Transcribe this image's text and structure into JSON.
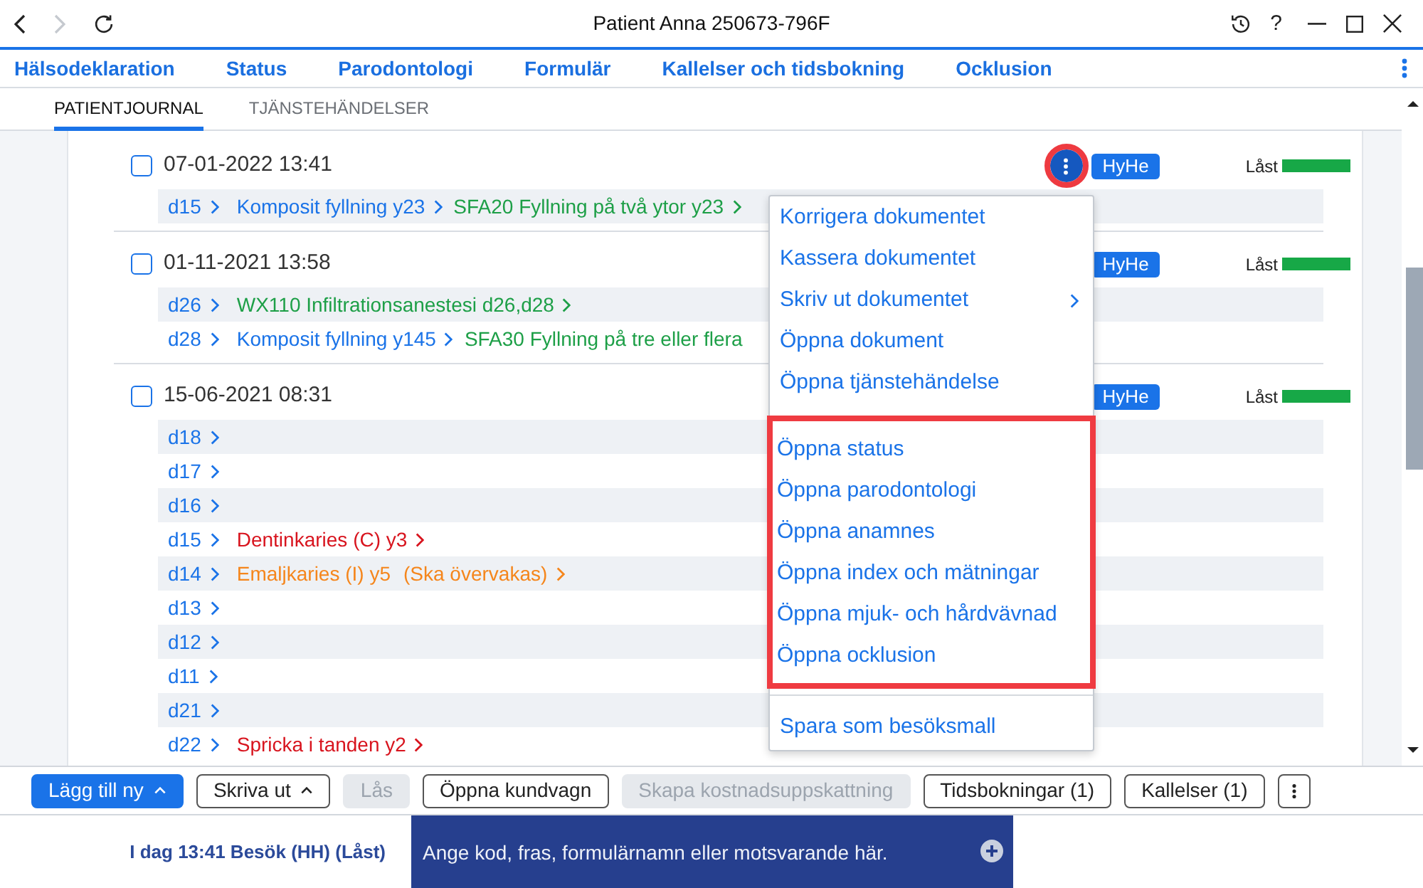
{
  "window": {
    "title": "Patient Anna 250673-796F",
    "help": "?"
  },
  "nav": {
    "items": [
      "Hälsodeklaration",
      "Status",
      "Parodontologi",
      "Formulär",
      "Kallelser och tidsbokning",
      "Ocklusion"
    ]
  },
  "subtabs": [
    {
      "label": "PATIENTJOURNAL",
      "selected": true
    },
    {
      "label": "TJÄNSTEHÄNDELSER",
      "selected": false
    }
  ],
  "entries": [
    {
      "date": "07-01-2022 13:41",
      "checked": false,
      "menu_button": {
        "highlighted": true
      },
      "badge": "HyHe",
      "lock": {
        "label": "Låst",
        "color": "#17a847"
      },
      "rows": [
        {
          "tooth": "d15",
          "items": [
            {
              "kind": "procedure",
              "text": "Komposit fyllning y23",
              "chevron": true
            },
            {
              "kind": "service",
              "text": "SFA20 Fyllning på två ytor y23",
              "chevron": true
            }
          ]
        }
      ]
    },
    {
      "date": "01-11-2021 13:58",
      "checked": false,
      "badge": "HyHe",
      "lock": {
        "label": "Låst",
        "color": "#17a847"
      },
      "rows": [
        {
          "tooth": "d26",
          "items": [
            {
              "kind": "service",
              "text": "WX110 Infiltrationsanestesi d26,d28",
              "chevron": true
            }
          ]
        },
        {
          "tooth": "d28",
          "items": [
            {
              "kind": "procedure",
              "text": "Komposit fyllning y145",
              "chevron": true
            },
            {
              "kind": "service",
              "text": "SFA30 Fyllning på tre eller flera",
              "chevron": false
            }
          ]
        }
      ]
    },
    {
      "date": "15-06-2021 08:31",
      "checked": false,
      "badge": "HyHe",
      "lock": {
        "label": "Låst",
        "color": "#17a847"
      },
      "rows": [
        {
          "tooth": "d18"
        },
        {
          "tooth": "d17"
        },
        {
          "tooth": "d16"
        },
        {
          "tooth": "d15",
          "items": [
            {
              "kind": "finding",
              "text": "Dentinkaries (C) y3",
              "chevron": true
            }
          ]
        },
        {
          "tooth": "d14",
          "items": [
            {
              "kind": "watch",
              "text": "Emaljkaries (I) y5",
              "note": "(Ska övervakas)",
              "chevron": true
            }
          ]
        },
        {
          "tooth": "d13"
        },
        {
          "tooth": "d12"
        },
        {
          "tooth": "d11"
        },
        {
          "tooth": "d21"
        },
        {
          "tooth": "d22",
          "items": [
            {
              "kind": "finding",
              "text": "Spricka i tanden y2",
              "chevron": true
            }
          ]
        }
      ]
    }
  ],
  "context_menu": {
    "groups": [
      {
        "highlighted": false,
        "items": [
          {
            "label": "Korrigera dokumentet",
            "submenu": false
          },
          {
            "label": "Kassera dokumentet",
            "submenu": false
          },
          {
            "label": "Skriv ut dokumentet",
            "submenu": true
          },
          {
            "label": "Öppna dokument",
            "submenu": false
          },
          {
            "label": "Öppna tjänstehändelse",
            "submenu": false
          }
        ]
      },
      {
        "highlighted": true,
        "items": [
          {
            "label": "Öppna status",
            "submenu": false
          },
          {
            "label": "Öppna parodontologi",
            "submenu": false
          },
          {
            "label": "Öppna anamnes",
            "submenu": false
          },
          {
            "label": "Öppna index och mätningar",
            "submenu": false
          },
          {
            "label": "Öppna mjuk- och hårdvävnad",
            "submenu": false
          },
          {
            "label": "Öppna ocklusion",
            "submenu": false
          }
        ]
      },
      {
        "highlighted": false,
        "items": [
          {
            "label": "Spara som besöksmall",
            "submenu": false
          }
        ]
      }
    ]
  },
  "toolbar": {
    "buttons": [
      {
        "kind": "primary",
        "label": "Lägg till ny",
        "caret": true,
        "disabled": false
      },
      {
        "kind": "outline",
        "label": "Skriva ut",
        "caret": true,
        "disabled": false
      },
      {
        "kind": "outline",
        "label": "Lås",
        "caret": false,
        "disabled": true
      },
      {
        "kind": "outline",
        "label": "Öppna kundvagn",
        "caret": false,
        "disabled": false
      },
      {
        "kind": "outline",
        "label": "Skapa kostnadsuppskattning",
        "caret": false,
        "disabled": true
      },
      {
        "kind": "outline",
        "label": "Tidsbokningar (1)",
        "caret": false,
        "disabled": false
      },
      {
        "kind": "outline",
        "label": "Kallelser (1)",
        "caret": false,
        "disabled": false
      },
      {
        "kind": "more",
        "disabled": false
      }
    ]
  },
  "status_bar": {
    "visit": "I dag 13:41 Besök (HH) (Låst)",
    "command_field": {
      "placeholder": "Ange kod, fras, formulärnamn eller motsvarande här."
    }
  }
}
